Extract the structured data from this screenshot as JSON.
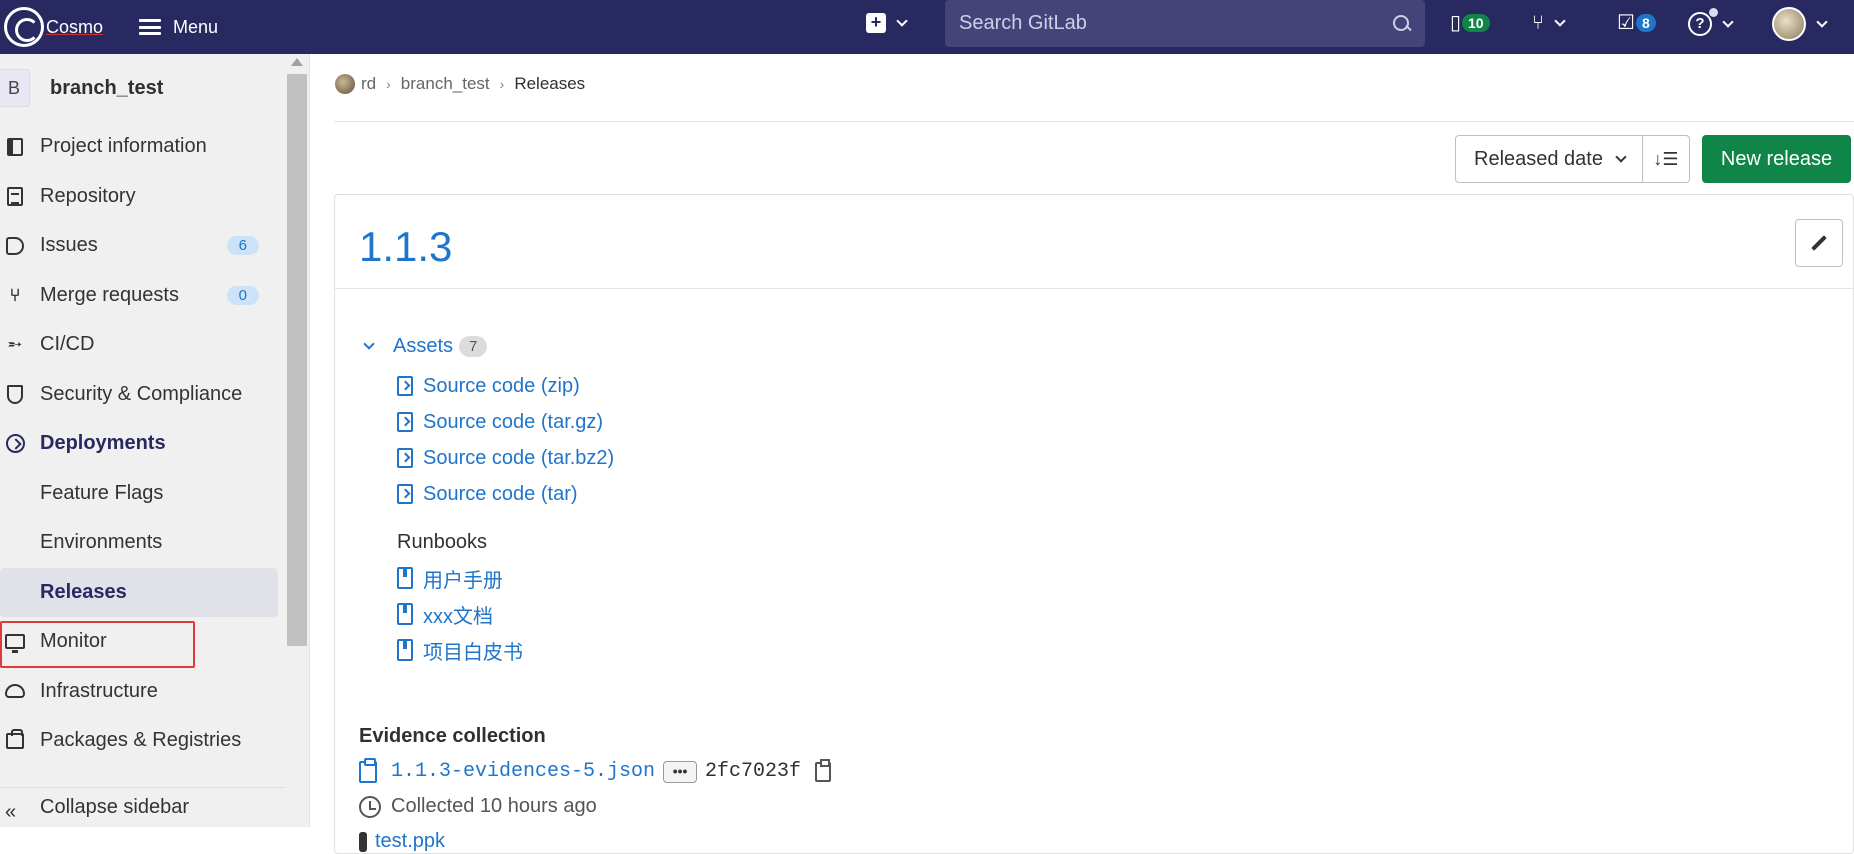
{
  "topbar": {
    "logo_text": "Cosmo",
    "menu_label": "Menu",
    "search_placeholder": "Search GitLab",
    "issues_count": "10",
    "todos_count": "8",
    "help_glyph": "?",
    "icons": [
      "plus-square-icon",
      "search-icon",
      "issues-icon",
      "merge-request-icon",
      "todo-icon",
      "help-icon",
      "user-avatar"
    ]
  },
  "sidebar": {
    "project_initial": "B",
    "project_name": "branch_test",
    "items": [
      {
        "label": "Project information",
        "icon": "book-icon"
      },
      {
        "label": "Repository",
        "icon": "doc-icon"
      },
      {
        "label": "Issues",
        "icon": "issues-icon",
        "count": "6"
      },
      {
        "label": "Merge requests",
        "icon": "merge-request-icon",
        "count": "0"
      },
      {
        "label": "CI/CD",
        "icon": "rocket-icon"
      },
      {
        "label": "Security & Compliance",
        "icon": "shield-icon"
      },
      {
        "label": "Deployments",
        "icon": "deployments-icon"
      },
      {
        "label": "Feature Flags"
      },
      {
        "label": "Environments"
      },
      {
        "label": "Releases"
      },
      {
        "label": "Monitor",
        "icon": "monitor-icon"
      },
      {
        "label": "Infrastructure",
        "icon": "cloud-icon"
      },
      {
        "label": "Packages & Registries",
        "icon": "package-icon"
      }
    ],
    "collapse_label": "Collapse sidebar"
  },
  "breadcrumb": {
    "group": "rd",
    "project": "branch_test",
    "current": "Releases"
  },
  "toolbar": {
    "sort_label": "Released date",
    "new_release_label": "New release"
  },
  "release": {
    "title": "1.1.3",
    "assets_label": "Assets",
    "assets_count": "7",
    "sources": [
      "Source code (zip)",
      "Source code (tar.gz)",
      "Source code (tar.bz2)",
      "Source code (tar)"
    ],
    "runbooks_heading": "Runbooks",
    "runbooks": [
      "用户手册",
      "xxx文档",
      "项目白皮书"
    ],
    "evidence_heading": "Evidence collection",
    "evidence_file": "1.1.3-evidences-5.json",
    "evidence_ellipsis": "•••",
    "evidence_sha": "2fc7023f",
    "collected_text": "Collected 10 hours ago",
    "extra_file": "test.ppk"
  },
  "colors": {
    "navbar": "#292961",
    "link": "#1f75cb",
    "primary_button": "#108548",
    "highlight_box": "#e23a3a"
  }
}
